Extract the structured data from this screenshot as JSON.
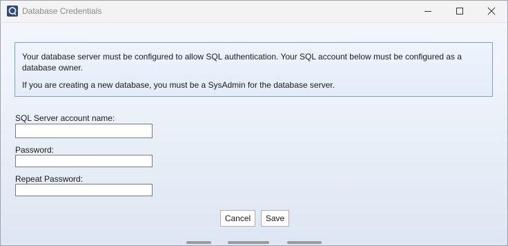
{
  "window": {
    "title": "Database Credentials",
    "icon": "app-icon"
  },
  "caption_buttons": {
    "minimize_icon": "minimize-icon",
    "maximize_icon": "maximize-icon",
    "close_icon": "close-icon"
  },
  "info": {
    "paragraph1": "Your database server must be configured to allow SQL authentication. Your SQL account below must be configured as a database owner.",
    "paragraph2": "If you are creating a new database, you must be a SysAdmin for the database server."
  },
  "form": {
    "account_label": "SQL Server account name:",
    "account_value": "",
    "password_label": "Password:",
    "password_value": "",
    "repeat_password_label": "Repeat Password:",
    "repeat_password_value": ""
  },
  "buttons": {
    "cancel": "Cancel",
    "save": "Save"
  },
  "colors": {
    "info_border": "#7aa0c4",
    "input_border": "#7a7a7a",
    "title_text": "#8a8a8a"
  }
}
